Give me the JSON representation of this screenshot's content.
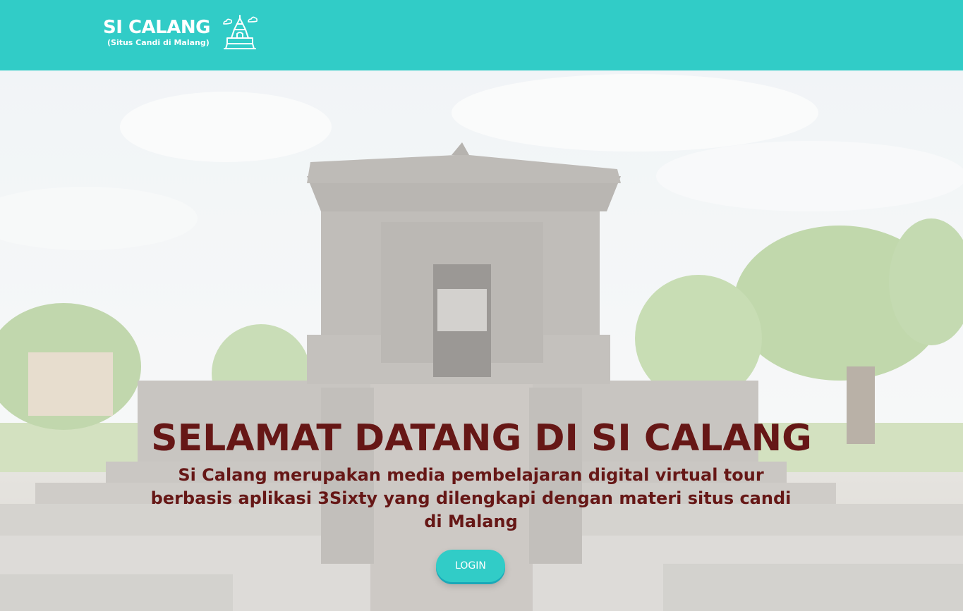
{
  "navbar": {
    "logo": {
      "title": "SI CALANG",
      "subtitle": "(Situs Candi di Malang)",
      "icon": "temple-icon"
    }
  },
  "hero": {
    "background_image": "temple-photo",
    "headline": "SELAMAT DATANG DI SI CALANG",
    "description": "Si Calang merupakan media pembelajaran digital virtual tour berbasis aplikasi 3Sixty yang dilengkapi dengan materi situs candi di Malang",
    "login_label": "LOGIN"
  },
  "colors": {
    "brand_teal": "#31ccc7",
    "headline_maroon": "#661716",
    "white": "#ffffff"
  }
}
